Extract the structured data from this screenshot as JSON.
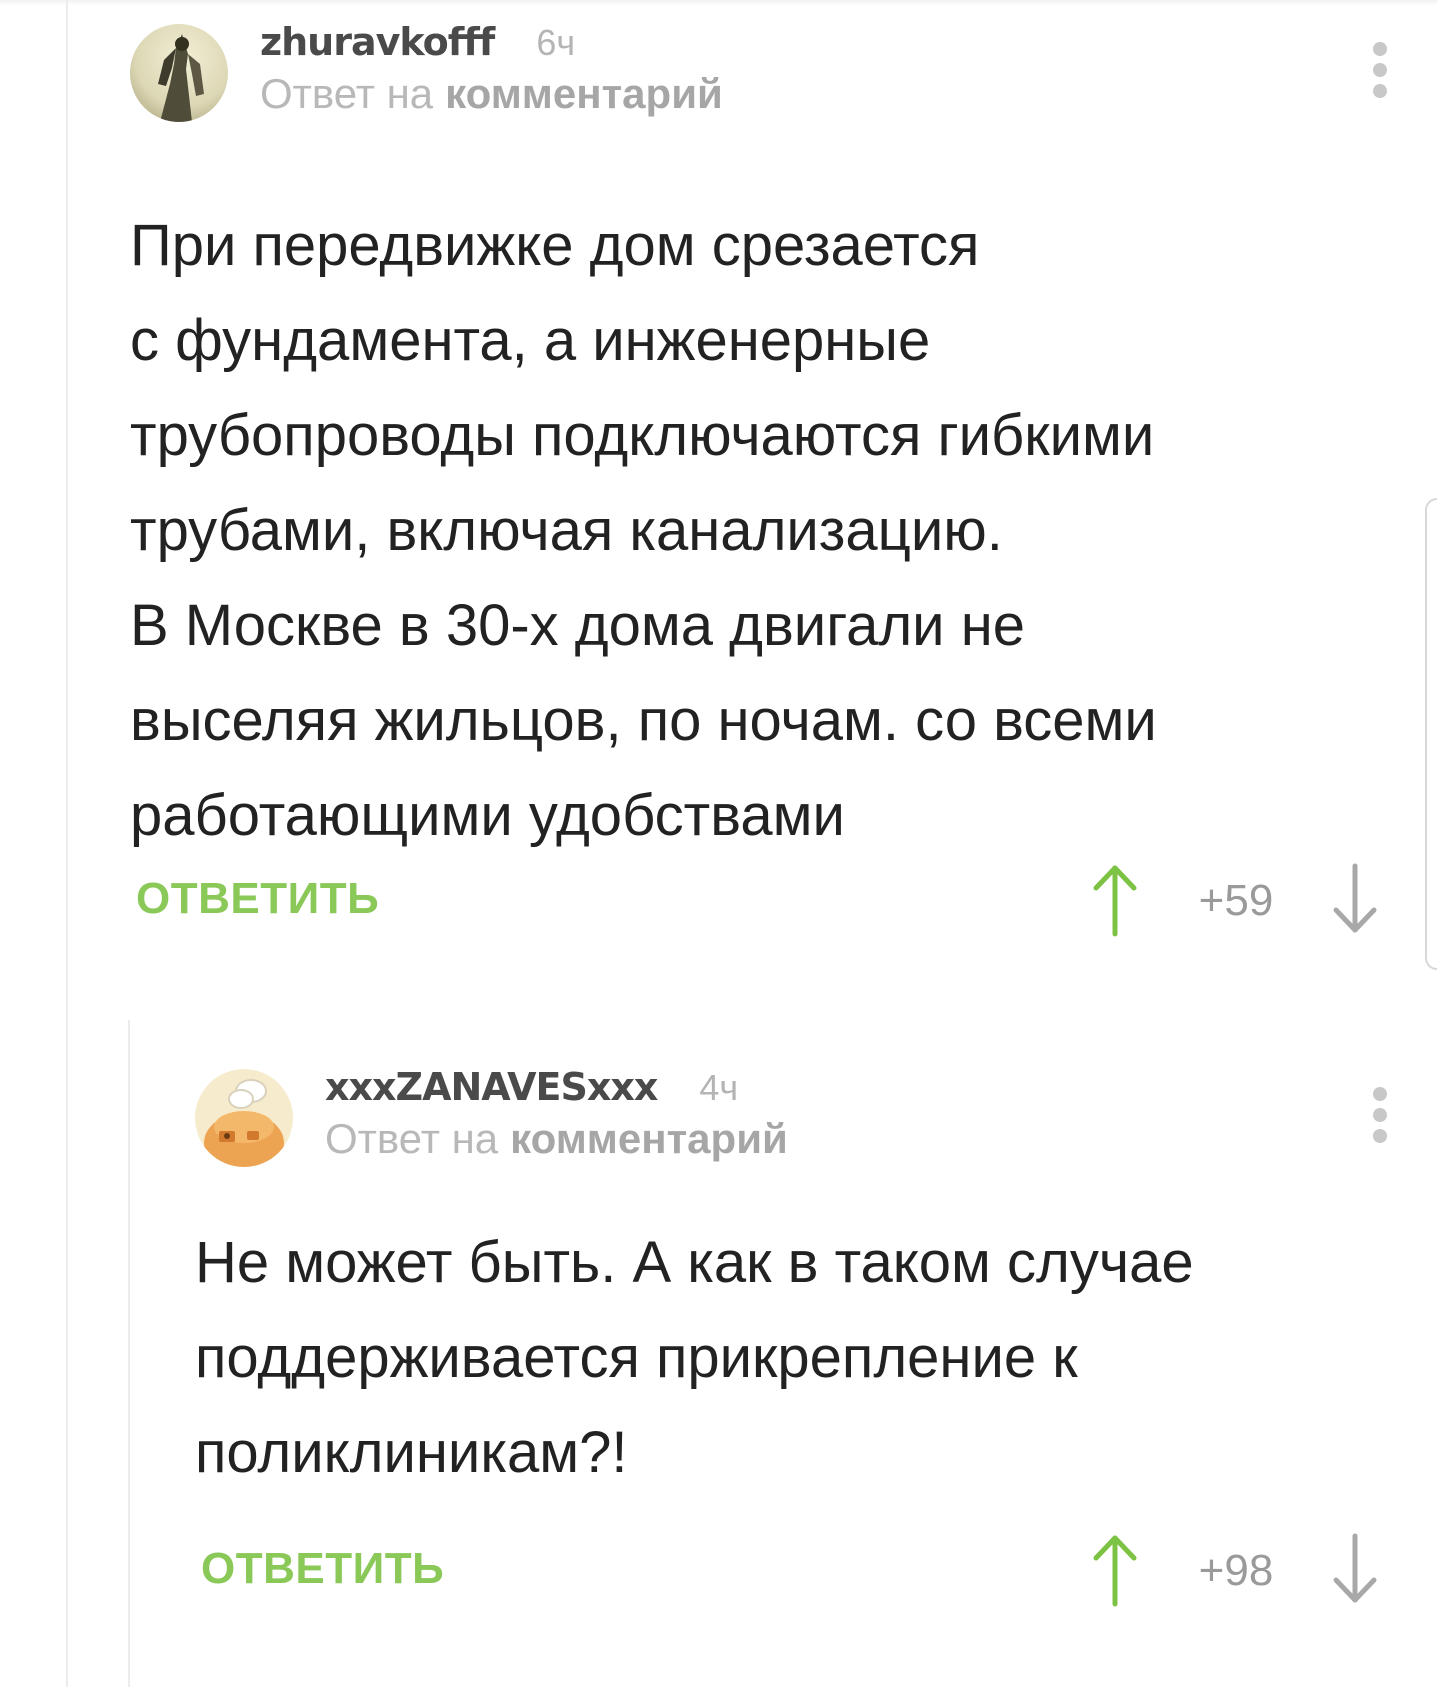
{
  "comments": [
    {
      "username": "zhuravkofff",
      "time": "6ч",
      "reply_prefix": "Ответ на",
      "reply_target": "комментарий",
      "text": "При передвижке дом срезается\nс фундамента, а инженерные\nтрубопроводы подключаются гибкими\nтрубами, включая канализацию.\nВ Москве в 30-х дома двигали не\nвыселяя жильцов, по ночам. со всеми\nработающими удобствами",
      "reply_label": "ОТВЕТИТЬ",
      "rating": "+59"
    },
    {
      "username": "xxxZANAVESxxx",
      "time": "4ч",
      "reply_prefix": "Ответ на",
      "reply_target": "комментарий",
      "text": "Не может быть. А как в таком случае\nподдерживается прикрепление к\nполиклиникам?!",
      "reply_label": "ОТВЕТИТЬ",
      "rating": "+98"
    }
  ],
  "icons": {
    "more": "vertical-dots-icon",
    "upvote": "arrow-up-icon",
    "downvote": "arrow-down-icon"
  },
  "colors": {
    "accent_green": "#8ac858",
    "upvote_active": "#7cc243",
    "muted_text": "#b8b8b8",
    "body_text": "#222222"
  }
}
